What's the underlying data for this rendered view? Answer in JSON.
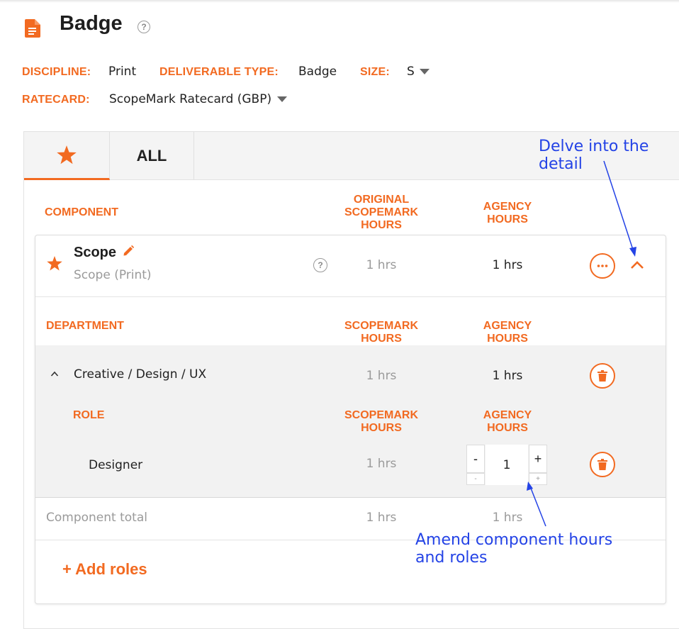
{
  "header": {
    "title": "Badge",
    "help_icon": "question-circle-icon",
    "doc_icon": "document-icon",
    "meta": {
      "discipline_label": "DISCIPLINE:",
      "discipline_value": "Print",
      "deliverable_label": "DELIVERABLE TYPE:",
      "deliverable_value": "Badge",
      "size_label": "SIZE:",
      "size_value": "S",
      "ratecard_label": "RATECARD:",
      "ratecard_value": "ScopeMark Ratecard (GBP)"
    }
  },
  "tabs": [
    {
      "icon": "star-icon",
      "active": true
    },
    {
      "label": "ALL",
      "active": false
    }
  ],
  "table": {
    "component_header": "COMPONENT",
    "original_hours_header": [
      "ORIGINAL",
      "SCOPEMARK",
      "HOURS"
    ],
    "agency_hours_header": [
      "AGENCY",
      "HOURS"
    ],
    "component": {
      "name": "Scope",
      "subtitle": "Scope (Print)",
      "original_hours": "1 hrs",
      "agency_hours": "1 hrs"
    },
    "department_header": "DEPARTMENT",
    "scopemark_hours_header": [
      "SCOPEMARK",
      "HOURS"
    ],
    "department": {
      "name": "Creative / Design / UX",
      "scopemark_hours": "1 hrs",
      "agency_hours": "1 hrs"
    },
    "role_header": "ROLE",
    "role": {
      "name": "Designer",
      "scopemark_hours": "1 hrs",
      "stepper_value": "1",
      "minus": "-",
      "plus": "+"
    },
    "total": {
      "label": "Component total",
      "scopemark_hours": "1 hrs",
      "agency_hours": "1 hrs"
    },
    "add_roles": "+ Add roles"
  },
  "annotations": {
    "detail": [
      "Delve into the",
      "detail"
    ],
    "amend": [
      "Amend component hours",
      "and roles"
    ]
  },
  "colors": {
    "accent": "#f26a21",
    "annotation": "#2443e6"
  }
}
